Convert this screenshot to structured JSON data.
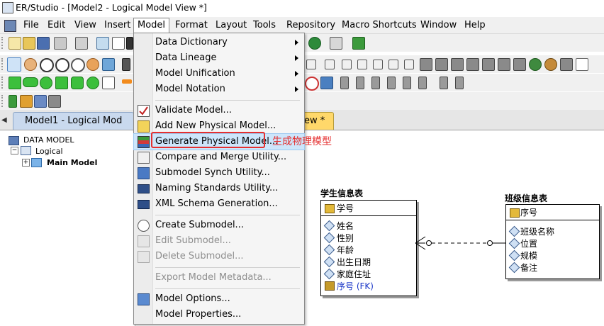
{
  "window": {
    "title": "ER/Studio - [Model2 - Logical Model View *]"
  },
  "menubar": {
    "items": [
      {
        "label": "File"
      },
      {
        "label": "Edit"
      },
      {
        "label": "View"
      },
      {
        "label": "Insert"
      },
      {
        "label": "Model"
      },
      {
        "label": "Format"
      },
      {
        "label": "Layout"
      },
      {
        "label": "Tools"
      },
      {
        "label": "Repository"
      },
      {
        "label": "Macro Shortcuts"
      },
      {
        "label": "Window"
      },
      {
        "label": "Help"
      }
    ],
    "active": "Model"
  },
  "tabs": {
    "left": "Model1 - Logical Mod",
    "right": "ew *"
  },
  "explorer": {
    "root": "DATA MODEL",
    "logical": "Logical",
    "main_model": "Main Model"
  },
  "dropdown": {
    "items": [
      {
        "label": "Data Dictionary",
        "submenu": true
      },
      {
        "label": "Data Lineage",
        "submenu": true
      },
      {
        "label": "Model Unification",
        "submenu": true
      },
      {
        "label": "Model Notation",
        "submenu": true
      },
      {
        "label": "Validate Model..."
      },
      {
        "label": "Add New Physical Model..."
      },
      {
        "label": "Generate Physical Model...",
        "highlighted": true
      },
      {
        "label": "Compare and Merge Utility..."
      },
      {
        "label": "Submodel Synch Utility..."
      },
      {
        "label": "Naming Standards Utility..."
      },
      {
        "label": "XML Schema Generation..."
      },
      {
        "label": "Create Submodel..."
      },
      {
        "label": "Edit Submodel...",
        "disabled": true
      },
      {
        "label": "Delete Submodel...",
        "disabled": true
      },
      {
        "label": "Export Model Metadata...",
        "disabled": true
      },
      {
        "label": "Model Options..."
      },
      {
        "label": "Model Properties..."
      }
    ],
    "annotation": "生成物理模型"
  },
  "entities": {
    "student": {
      "title": "学生信息表",
      "key": "学号",
      "attributes": [
        "姓名",
        "性别",
        "年龄",
        "出生日期",
        "家庭住址"
      ],
      "fk": "序号 (FK)"
    },
    "class": {
      "title": "班级信息表",
      "key": "序号",
      "attributes": [
        "班级名称",
        "位置",
        "规模",
        "备注"
      ]
    }
  },
  "colors": {
    "annotation": "#e53030",
    "fk_text": "#1a36c8",
    "highlight": "#cde6fb"
  }
}
